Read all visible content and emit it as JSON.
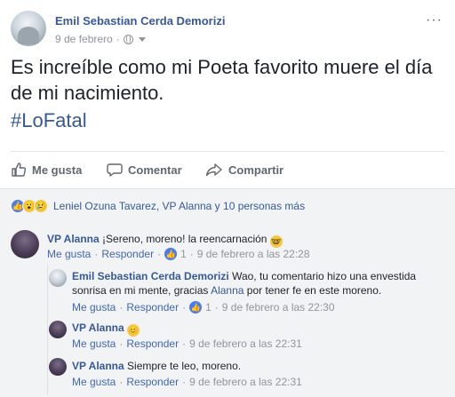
{
  "post": {
    "author": "Emil Sebastian Cerda Demorizi",
    "date": "9 de febrero",
    "date_sep": "·",
    "text": "Es increíble como mi Poeta favorito muere el día de mi nacimiento.",
    "hashtag": "#LoFatal",
    "more": "···"
  },
  "actions": {
    "like": "Me gusta",
    "comment": "Comentar",
    "share": "Compartir"
  },
  "reactions": {
    "names": "Leniel Ozuna Tavarez, VP Alanna y 10 personas más"
  },
  "comments": [
    {
      "author": "VP Alanna",
      "text": "¡Sereno, moreno! la reencarnación",
      "emoji": "🤓",
      "like": "Me gusta",
      "reply": "Responder",
      "likes": "1",
      "time": "9 de febrero a las 22:28"
    },
    {
      "author": "Emil Sebastian Cerda Demorizi",
      "text_before": "Wao, tu comentario hizo una envestida sonrisa en mi mente, gracias",
      "mention": "Alanna",
      "text_after": "por tener fe en este moreno.",
      "like": "Me gusta",
      "reply": "Responder",
      "likes": "1",
      "time": "9 de febrero a las 22:30"
    },
    {
      "author": "VP Alanna",
      "emoji": "😊",
      "like": "Me gusta",
      "reply": "Responder",
      "time": "9 de febrero a las 22:31"
    },
    {
      "author": "VP Alanna",
      "text": "Siempre te leo, moreno.",
      "like": "Me gusta",
      "reply": "Responder",
      "time": "9 de febrero a las 22:31"
    }
  ],
  "colors": {
    "link": "#365899",
    "meta": "#90949c",
    "like_blue": "#4a7bf0",
    "comments_bg": "#f2f3f5"
  }
}
